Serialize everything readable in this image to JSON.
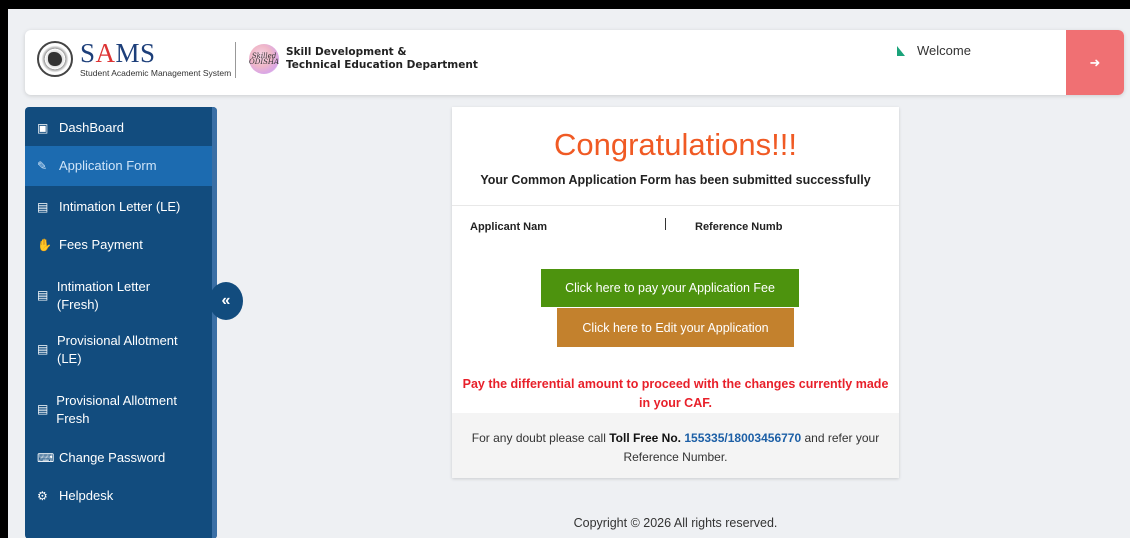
{
  "header": {
    "logo_title_prefix": "S",
    "logo_title_accent": "A",
    "logo_title_suffix": "MS",
    "logo_subtitle": "Student Academic Management System",
    "dept_line1": "Skill Development &",
    "dept_line2": "Technical Education Department",
    "welcome": "Welcome",
    "logout_icon": "sign-out-icon",
    "accent_color": "#f07073"
  },
  "sidebar": {
    "items": [
      {
        "icon": "dashboard-icon",
        "glyph": "🖳",
        "label": "DashBoard",
        "active": false
      },
      {
        "icon": "edit-form-icon",
        "glyph": "✎",
        "label": "Application Form",
        "active": true
      },
      {
        "icon": "document-icon",
        "glyph": "🗎",
        "label": "Intimation Letter (LE)",
        "active": false
      },
      {
        "icon": "hand-money-icon",
        "glyph": "🤲",
        "label": "Fees Payment",
        "active": false
      },
      {
        "icon": "document-icon",
        "glyph": "🗎",
        "label": "Intimation Letter (Fresh)",
        "active": false
      },
      {
        "icon": "document-icon",
        "glyph": "🗎",
        "label": "Provisional Allotment (LE)",
        "active": false
      },
      {
        "icon": "document-icon",
        "glyph": "🗎",
        "label": "Provisional Allotment Fresh",
        "active": false
      },
      {
        "icon": "password-icon",
        "glyph": "⌨",
        "label": "Change Password",
        "active": false
      },
      {
        "icon": "helpdesk-icon",
        "glyph": "⚙",
        "label": "Helpdesk",
        "active": false
      }
    ],
    "collapse": "«",
    "color": "#124c7e"
  },
  "main": {
    "title": "Congratulations!!!",
    "subtitle": "Your Common Application Form has been submitted successfully",
    "applicant_label": "Applicant Nam",
    "reference_label": "Reference Numb",
    "pay_button": "Click here to pay your Application Fee",
    "edit_button": "Click here to Edit your Application",
    "warning": "Pay the differential amount to proceed with the changes currently made in your CAF.",
    "help_prefix": "For any doubt please call ",
    "help_tollfree": "Toll Free No.",
    "help_phone": "155335/18003456770",
    "help_suffix": " and refer your Reference Number.",
    "pay_color": "#4d930e",
    "edit_color": "#c3812d",
    "warning_color": "#e8202a"
  },
  "footer": {
    "copyright": "Copyright © 2026 All rights reserved."
  }
}
